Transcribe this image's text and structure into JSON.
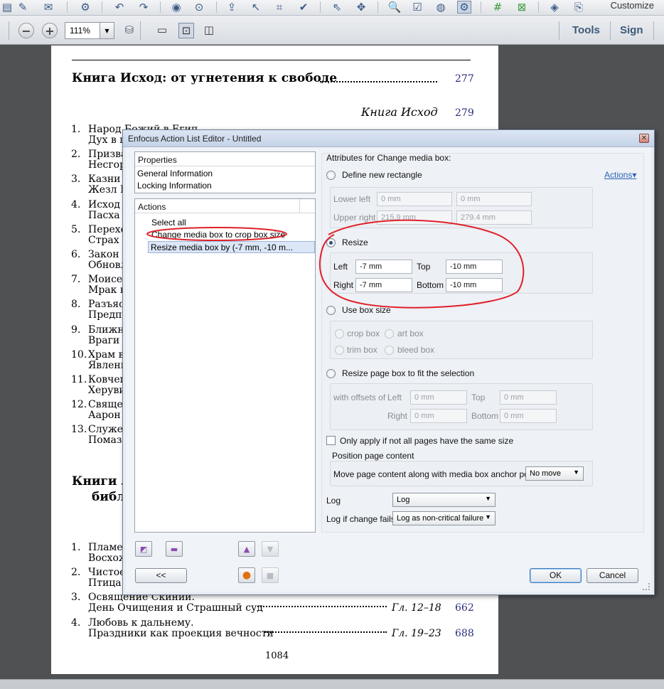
{
  "toolbar": {
    "customize": "Customize",
    "zoom": "111%",
    "tools": "Tools",
    "sign": "Sign"
  },
  "document": {
    "heading": "Книга Исход: от угнетения к свободе",
    "heading_page": "277",
    "subheading": "Книга Исход",
    "subheading_page": "279",
    "items": [
      {
        "n": "1.",
        "l1": "Народ Божий в Егип",
        "l2": "Дух в плену"
      },
      {
        "n": "2.",
        "l1": "Призва",
        "l2": "Несгор"
      },
      {
        "n": "3.",
        "l1": "Казни",
        "l2": "Жезл М"
      },
      {
        "n": "4.",
        "l1": "Исход",
        "l2": "Пасха"
      },
      {
        "n": "5.",
        "l1": "Перехо",
        "l2": "Страх"
      },
      {
        "n": "6.",
        "l1": "Закон",
        "l2": "Обновл"
      },
      {
        "n": "7.",
        "l1": "Моисей",
        "l2": "Мрак в"
      },
      {
        "n": "8.",
        "l1": "Разъяс",
        "l2": "Предпи"
      },
      {
        "n": "9.",
        "l1": "Ближн",
        "l2": "Враги"
      },
      {
        "n": "10.",
        "l1": "Храм в",
        "l2": "Явлени"
      },
      {
        "n": "11.",
        "l1": "Ковчег",
        "l2": "Херуви"
      },
      {
        "n": "12.",
        "l1": "Священ",
        "l2": "Аарон"
      },
      {
        "n": "13.",
        "l1": "Служен",
        "l2": "Помаза"
      }
    ],
    "heading2_l1": "Книги Л",
    "heading2_l2": "библ",
    "items2": [
      {
        "n": "1.",
        "l1": "Пламен",
        "l2": "Восхож"
      },
      {
        "n": "2.",
        "l1": "Чистое",
        "l2": "Птица"
      },
      {
        "n": "3.",
        "l1": "Освящение Скинии.",
        "l2": "День Очищения и Страшный суд",
        "ref": "Гл. 12–18",
        "page": "662"
      },
      {
        "n": "4.",
        "l1": "Любовь к дальнему.",
        "l2": "Праздники как проекция вечности",
        "ref": "Гл. 19–23",
        "page": "688"
      }
    ],
    "footer": "1084"
  },
  "dialog": {
    "title": "Enfocus Action List Editor - Untitled",
    "properties_header": "Properties",
    "properties_items": [
      "General Information",
      "Locking Information"
    ],
    "actions_header": "Actions",
    "actions_items": [
      "Select all",
      "Change media box to crop box size",
      "Resize media box by (-7 mm, -10 m..."
    ],
    "collapse_button": "<<",
    "attributes_header": "Attributes for Change media box:",
    "actions_link": "Actions",
    "define_new_rect": "Define new rectangle",
    "lower_left": "Lower left",
    "upper_right": "Upper right",
    "ll_x": "0 mm",
    "ll_y": "0 mm",
    "ur_x": "215.9 mm",
    "ur_y": "279.4 mm",
    "resize": "Resize",
    "left_label": "Left",
    "left_value": "-7 mm",
    "top_label": "Top",
    "top_value": "-10 mm",
    "right_label": "Right",
    "right_value": "-7 mm",
    "bottom_label": "Bottom",
    "bottom_value": "-10 mm",
    "use_box_size": "Use box size",
    "crop_box": "crop box",
    "art_box": "art box",
    "trim_box": "trim box",
    "bleed_box": "bleed box",
    "resize_page_box": "Resize page box to fit the selection",
    "with_offsets_of": "with offsets of",
    "off_left": "Left",
    "off_top": "Top",
    "off_right": "Right",
    "off_bottom": "Bottom",
    "off_left_val": "0 mm",
    "off_top_val": "0 mm",
    "off_right_val": "0 mm",
    "off_bottom_val": "0 mm",
    "only_apply": "Only apply if not all pages have the same size",
    "position_content": "Position page content",
    "move_content": "Move page content along with media box anchor point:",
    "move_value": "No move",
    "log_label": "Log",
    "log_value": "Log",
    "log_fail_label": "Log if change fails",
    "log_fail_value": "Log as non-critical failure",
    "ok": "OK",
    "cancel": "Cancel"
  },
  "colors": {
    "annotation": "#e0202a",
    "page_number": "#2b2d7a",
    "selection": "#dbe6f6"
  }
}
